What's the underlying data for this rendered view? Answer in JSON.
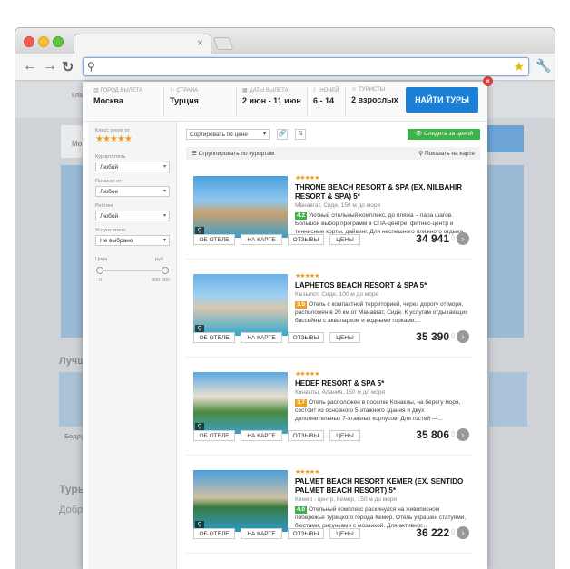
{
  "browser": {
    "url_value": "",
    "tab_close": "×"
  },
  "search": {
    "fields": [
      {
        "label": "Город вылета",
        "value": "Москва"
      },
      {
        "label": "Страна",
        "value": "Турция"
      },
      {
        "label": "Даты вылета",
        "value": "2 июн - 11 июн"
      },
      {
        "label": "Ночей",
        "value": "6 - 14"
      },
      {
        "label": "Туристы",
        "value": "2 взрослых"
      }
    ],
    "find_button": "НАЙТИ ТУРЫ"
  },
  "filters": {
    "hotel_class_label": "Класс отеля от",
    "hotel_class_stars": "★★★★★",
    "resort_label": "Курорт/отель",
    "resort_value": "Любой",
    "meal_label": "Питание от",
    "meal_value": "Любое",
    "rating_label": "Рейтинг",
    "rating_value": "Любой",
    "services_label": "Услуги отеля",
    "services_value": "Не выбрано",
    "price_label": "Цена",
    "currency": "руб",
    "price_min": "0",
    "price_max": "900 000"
  },
  "toolbar": {
    "sort_value": "Сортировать по цене",
    "follow_label": "Следить за ценой",
    "group_label": "Сгруппировать по курортам",
    "map_label": "Показать на карте"
  },
  "hotels": [
    {
      "stars": "★★★★★",
      "name": "THRONE BEACH RESORT & SPA (EX. NILBAHIR RESORT & SPA) 5*",
      "location": "Манавгат, Сиде, 150 м до моря",
      "rating": "4.2",
      "rating_color": "#3bb24a",
      "description": "Уютный отельный комплекс, до пляжа – пара шагов. Большой выбор программ в СПА-центре, фитнес-центр и теннисные корты, дайвинг. Для неспешного пляжного отдыха.",
      "price": "34 941"
    },
    {
      "stars": "★★★★★",
      "name": "LAPHETOS BEACH RESORT & SPA 5*",
      "location": "Кызылот, Сиде, 100 м до моря",
      "rating": "3.5",
      "rating_color": "#f0a020",
      "description": "Отель с компактной территорией, через дорогу от моря, расположен в 20 км от Манавгат, Сиде. К услугам отдыхающих бассейны с аквапарком и водными горками,...",
      "price": "35 390"
    },
    {
      "stars": "★★★★★",
      "name": "HEDEF RESORT & SPA 5*",
      "location": "Конаклы, Алания, 150 м до моря",
      "rating": "3.7",
      "rating_color": "#f0a020",
      "description": "Отель расположен в поселке Конаклы, на берегу моря, состоит из основного 5-этажного здания и двух дополнительных 7-этажных корпусов. Для гостей —...",
      "price": "35 806"
    },
    {
      "stars": "★★★★★",
      "name": "PALMET BEACH RESORT KEMER (EX. SENTIDO PALMET BEACH RESORT) 5*",
      "location": "Кемер - центр, Кемер, 150 м до моря",
      "rating": "4.0",
      "rating_color": "#3bb24a",
      "description": "Отельный комплекс раскинулся на живописном побережье турецкого города Кемер. Отель украшен статуями, бюстами, рисунками с мозаикой. Для активног...",
      "price": "36 222"
    }
  ],
  "card_actions": {
    "about": "ОБ ОТЕЛЕ",
    "map": "НА КАРТЕ",
    "reviews": "ОТЗЫВЫ",
    "prices": "ЦЕНЫ"
  },
  "background": {
    "nav_fragment": "Глав",
    "city_fragment": "Мо",
    "best_fragment": "Лучш",
    "tours_fragment": "Туры",
    "good_fragment": "Добр",
    "bodr_fragment": "Бодру"
  }
}
